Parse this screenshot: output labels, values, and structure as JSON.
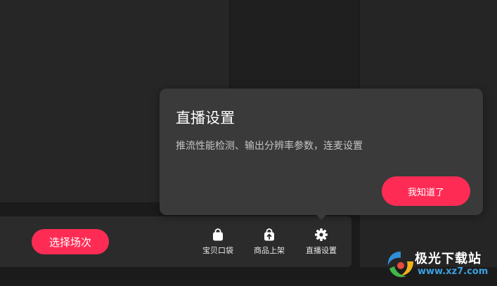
{
  "toolbar": {
    "select_session_label": "选择场次",
    "tools": [
      {
        "label": "宝贝口袋",
        "icon": "bag-icon"
      },
      {
        "label": "商品上架",
        "icon": "upload-bag-icon"
      },
      {
        "label": "直播设置",
        "icon": "gear-icon"
      }
    ]
  },
  "tooltip": {
    "title": "直播设置",
    "description": "推流性能检测、输出分辨率参数，连麦设置",
    "confirm_label": "我知道了"
  },
  "watermark": {
    "text": "极光下载站",
    "url": "www.xz7.com"
  },
  "colors": {
    "accent": "#fe2c55",
    "tooltip_bg": "#3a3a3a",
    "background": "#1b1b1b"
  }
}
